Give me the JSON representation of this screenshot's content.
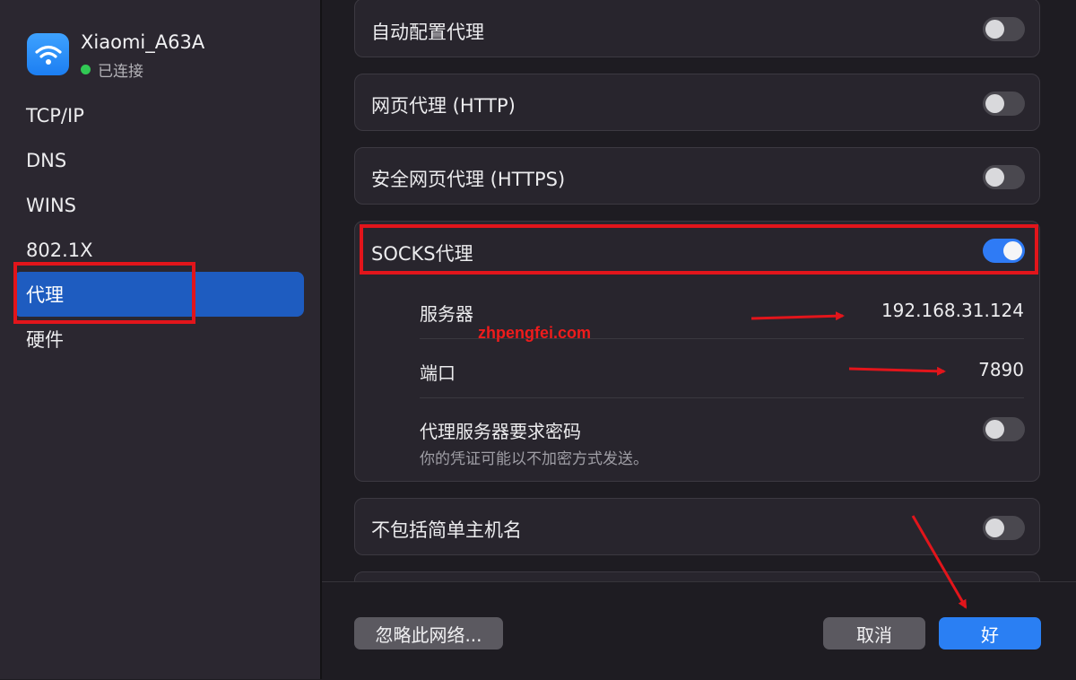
{
  "sidebar": {
    "network": {
      "name": "Xiaomi_A63A",
      "status": "已连接",
      "status_color": "#31c954",
      "icon": "wifi-icon"
    },
    "items": [
      {
        "label": "TCP/IP"
      },
      {
        "label": "DNS"
      },
      {
        "label": "WINS"
      },
      {
        "label": "802.1X"
      },
      {
        "label": "代理",
        "selected": true
      },
      {
        "label": "硬件"
      }
    ]
  },
  "proxies": {
    "auto_config": {
      "label": "自动配置代理",
      "enabled": false
    },
    "http": {
      "label": "网页代理 (HTTP)",
      "enabled": false
    },
    "https": {
      "label": "安全网页代理 (HTTPS)",
      "enabled": false
    },
    "socks": {
      "label": "SOCKS代理",
      "enabled": true,
      "server_label": "服务器",
      "server_value": "192.168.31.124",
      "port_label": "端口",
      "port_value": "7890",
      "auth_label": "代理服务器要求密码",
      "auth_desc": "你的凭证可能以不加密方式发送。",
      "auth_enabled": false
    },
    "exclude_simple": {
      "label": "不包括简单主机名",
      "enabled": false
    }
  },
  "footer": {
    "forget_label": "忽略此网络...",
    "cancel_label": "取消",
    "ok_label": "好"
  },
  "watermark": "zhpengfei.com",
  "colors": {
    "accent": "#2a7ff3",
    "selection": "#1e5cc0",
    "annotation": "#e2151b"
  }
}
